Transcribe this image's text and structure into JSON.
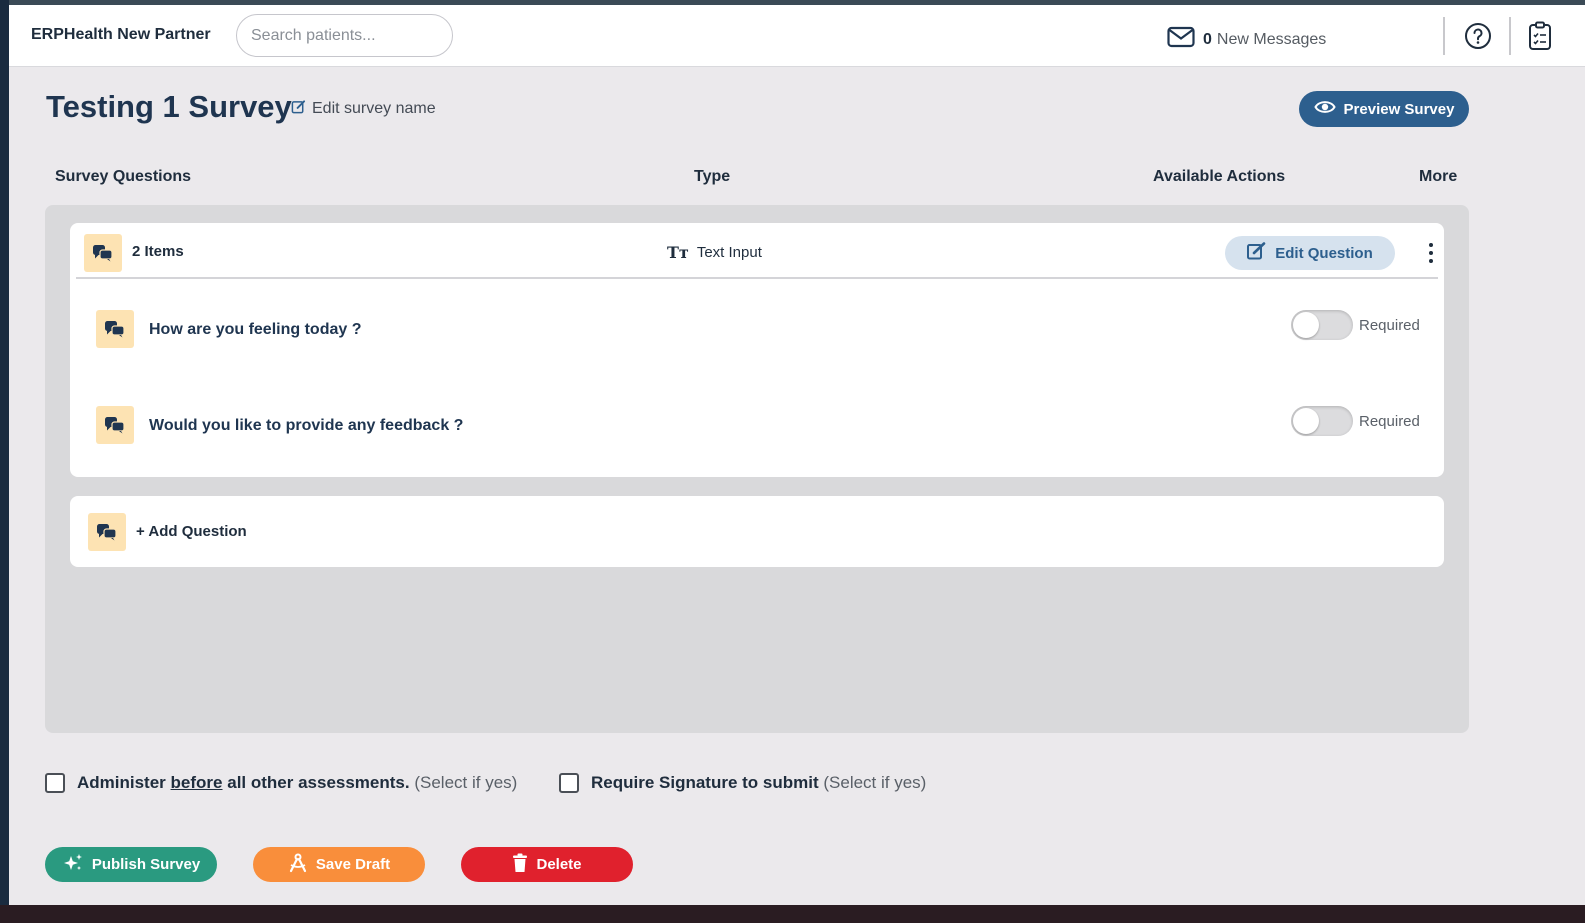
{
  "header": {
    "brand": "ERPHealth New Partner",
    "search_placeholder": "Search patients...",
    "messages_count": "0",
    "messages_label": "New Messages"
  },
  "survey": {
    "title": "Testing 1 Survey",
    "edit_name_label": "Edit survey name",
    "preview_label": "Preview Survey"
  },
  "columns": {
    "questions": "Survey Questions",
    "type": "Type",
    "actions": "Available Actions",
    "more": "More"
  },
  "group": {
    "count_label": "2 Items",
    "type_label": "Text Input",
    "edit_label": "Edit Question",
    "questions": [
      {
        "text": "How are you feeling today ?",
        "required_label": "Required",
        "required": false
      },
      {
        "text": "Would you like to provide any feedback ?",
        "required_label": "Required",
        "required": false
      }
    ]
  },
  "add_question_label": "+ Add Question",
  "options": {
    "administer_pre": "Administer",
    "administer_emph": "before",
    "administer_post": "all other assessments.",
    "administer_hint": "(Select if yes)",
    "signature_label": "Require Signature to submit",
    "signature_hint": "(Select if yes)"
  },
  "actions": {
    "publish": "Publish Survey",
    "draft": "Save Draft",
    "delete": "Delete"
  },
  "colors": {
    "primary": "#2d5f8e",
    "publish": "#2a9a80",
    "draft": "#f98e3b",
    "delete": "#e0212d",
    "question_icon_bg": "#fde3b3"
  }
}
